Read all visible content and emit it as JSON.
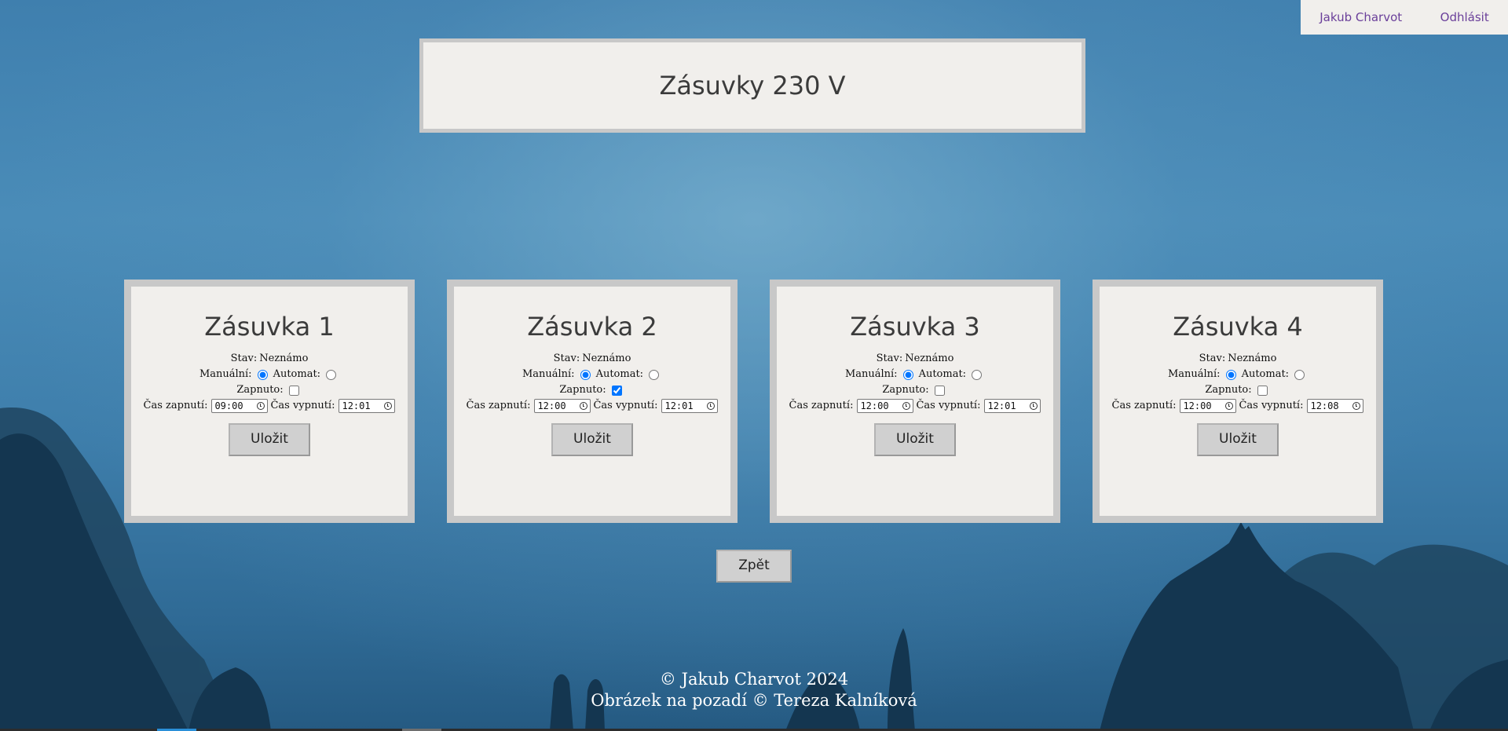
{
  "nav": {
    "user_label": "Jakub Charvot",
    "logout_label": "Odhlásit"
  },
  "page": {
    "title": "Zásuvky 230 V"
  },
  "sockets": [
    {
      "name": "Zásuvka 1",
      "status_label": "Stav:",
      "status_value": "Neznámo",
      "manual_label": "Manuální:",
      "auto_label": "Automat:",
      "on_label": "Zapnuto:",
      "on_time_label": "Čas zapnutí:",
      "on_time": "09:00",
      "off_time_label": "Čas vypnutí:",
      "off_time": "12:01",
      "save_label": "Uložit",
      "mode": "manual",
      "on": false
    },
    {
      "name": "Zásuvka 2",
      "status_label": "Stav:",
      "status_value": "Neznámo",
      "manual_label": "Manuální:",
      "auto_label": "Automat:",
      "on_label": "Zapnuto:",
      "on_time_label": "Čas zapnutí:",
      "on_time": "12:00",
      "off_time_label": "Čas vypnutí:",
      "off_time": "12:01",
      "save_label": "Uložit",
      "mode": "manual",
      "on": true
    },
    {
      "name": "Zásuvka 3",
      "status_label": "Stav:",
      "status_value": "Neznámo",
      "manual_label": "Manuální:",
      "auto_label": "Automat:",
      "on_label": "Zapnuto:",
      "on_time_label": "Čas zapnutí:",
      "on_time": "12:00",
      "off_time_label": "Čas vypnutí:",
      "off_time": "12:01",
      "save_label": "Uložit",
      "mode": "manual",
      "on": false
    },
    {
      "name": "Zásuvka 4",
      "status_label": "Stav:",
      "status_value": "Neznámo",
      "manual_label": "Manuální:",
      "auto_label": "Automat:",
      "on_label": "Zapnuto:",
      "on_time_label": "Čas zapnutí:",
      "on_time": "12:00",
      "off_time_label": "Čas vypnutí:",
      "off_time": "12:08",
      "save_label": "Uložit",
      "mode": "manual",
      "on": false
    }
  ],
  "back_label": "Zpět",
  "footer": {
    "line1": "© Jakub Charvot 2024",
    "line2": "Obrázek na pozadí © Tereza Kalníková"
  },
  "colors": {
    "accent_link": "#6a3f9a",
    "card_bg": "#f1efec",
    "card_border": "#c8c8c8",
    "water_bg": "#3f7fae"
  }
}
